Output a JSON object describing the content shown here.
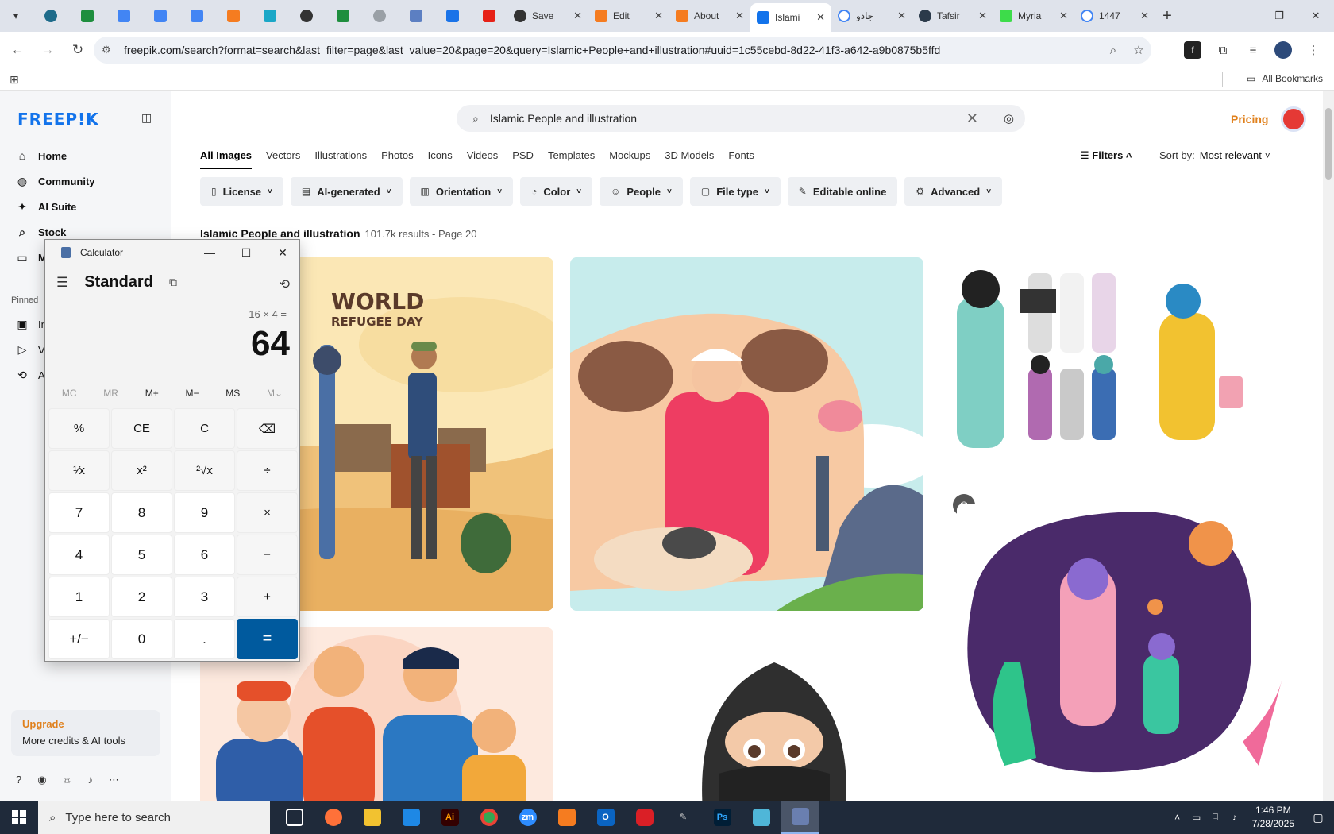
{
  "browser": {
    "tabs": [
      {
        "label": "Save",
        "favicon": "chatgpt-icon",
        "active": false
      },
      {
        "label": "Edit",
        "favicon": "xampp-icon",
        "active": false
      },
      {
        "label": "About",
        "favicon": "xampp-icon",
        "active": false
      },
      {
        "label": "Islami",
        "favicon": "freepik-icon",
        "active": true
      },
      {
        "label": "جادو",
        "favicon": "google-icon",
        "active": false
      },
      {
        "label": "Tafsir",
        "favicon": "globe-icon",
        "active": false
      },
      {
        "label": "Myria",
        "favicon": "myriad-icon",
        "active": false
      },
      {
        "label": "1447",
        "favicon": "google-icon",
        "active": false
      }
    ],
    "url": "freepik.com/search?format=search&last_filter=page&last_value=20&page=20&query=Islamic+People+and+illustration#uuid=1c55cebd-8d22-41f3-a642-a9b0875b5ffd",
    "bookmarks_label": "All Bookmarks"
  },
  "sidebar": {
    "logo": "FREEP!K",
    "nav": [
      {
        "label": "Home",
        "icon": "home-icon"
      },
      {
        "label": "Community",
        "icon": "globe-icon"
      },
      {
        "label": "AI Suite",
        "icon": "sparkle-icon"
      },
      {
        "label": "Stock",
        "icon": "search-icon"
      },
      {
        "label": "M",
        "icon": "folder-icon"
      }
    ],
    "pinned_label": "Pinned",
    "pinned": [
      {
        "label": "Im",
        "icon": "image-icon"
      },
      {
        "label": "Vi",
        "icon": "video-icon"
      },
      {
        "label": "A",
        "icon": "ai-icon"
      }
    ],
    "upgrade_title": "Upgrade",
    "upgrade_text": "More credits & AI tools"
  },
  "main": {
    "search_query": "Islamic People and illustration",
    "pricing": "Pricing",
    "categories": [
      "All Images",
      "Vectors",
      "Illustrations",
      "Photos",
      "Icons",
      "Videos",
      "PSD",
      "Templates",
      "Mockups",
      "3D Models",
      "Fonts"
    ],
    "filters_label": "Filters",
    "sort_label": "Sort by:",
    "sort_value": "Most relevant",
    "chips": [
      {
        "label": "License",
        "icon": "license-icon"
      },
      {
        "label": "AI-generated",
        "icon": "ai-icon"
      },
      {
        "label": "Orientation",
        "icon": "orientation-icon"
      },
      {
        "label": "Color",
        "icon": "palette-icon"
      },
      {
        "label": "People",
        "icon": "people-icon"
      },
      {
        "label": "File type",
        "icon": "file-icon"
      },
      {
        "label": "Editable online",
        "icon": "pencil-icon"
      },
      {
        "label": "Advanced",
        "icon": "gear-icon"
      }
    ],
    "results_title": "Islamic People and illustration",
    "results_meta": "101.7k results - Page 20",
    "card1_title_line1": "WORLD",
    "card1_title_line2": "REFUGEE DAY"
  },
  "calculator": {
    "app_name": "Calculator",
    "mode": "Standard",
    "expression": "16 × 4 =",
    "display": "64",
    "memory": [
      "MC",
      "MR",
      "M+",
      "M−",
      "MS",
      "M⌄"
    ],
    "keys": [
      "%",
      "CE",
      "C",
      "⌫",
      "¹⁄x",
      "x²",
      "²√x",
      "÷",
      "7",
      "8",
      "9",
      "×",
      "4",
      "5",
      "6",
      "−",
      "1",
      "2",
      "3",
      "+",
      "+/−",
      "0",
      ".",
      "="
    ]
  },
  "taskbar": {
    "search_placeholder": "Type here to search",
    "time": "1:46 PM",
    "date": "7/28/2025"
  },
  "colors": {
    "accent": "#1273eb",
    "pricing": "#e0801c",
    "calc_equals": "#005a9e"
  }
}
